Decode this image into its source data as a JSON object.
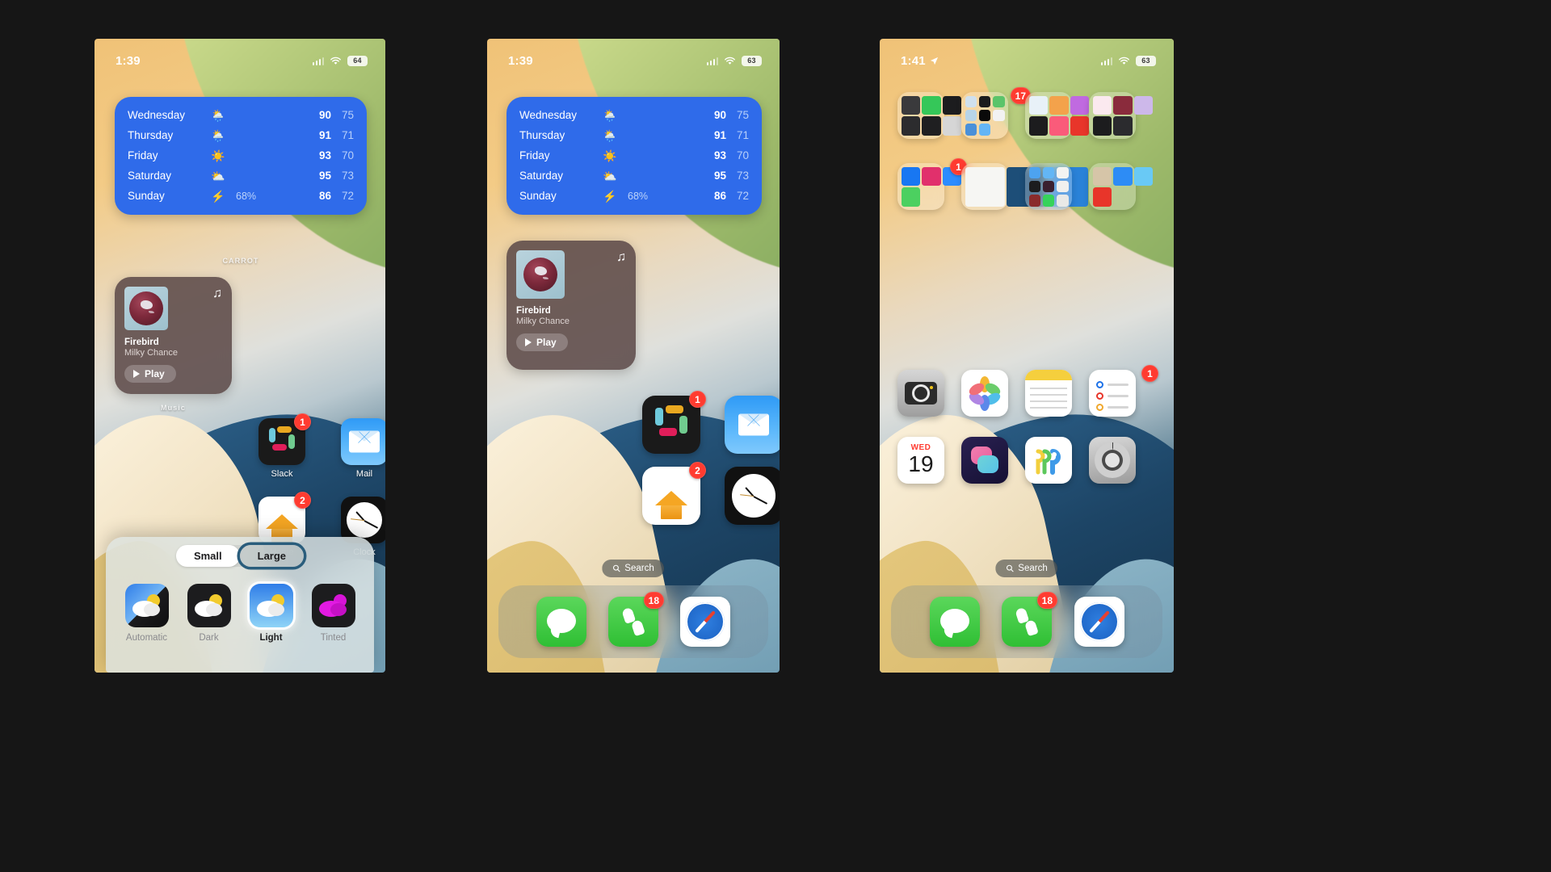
{
  "screens": [
    {
      "id": "screen-edit-mode",
      "status_bar": {
        "time": "1:39",
        "location_arrow": false,
        "battery": "64"
      },
      "weather_widget": {
        "caption": "CARROT",
        "rows": [
          {
            "day": "Wednesday",
            "icon": "rain-sun-icon",
            "glyph": "🌦️",
            "precip": "",
            "high": "90",
            "low": "75"
          },
          {
            "day": "Thursday",
            "icon": "rain-sun-icon",
            "glyph": "🌦️",
            "precip": "",
            "high": "91",
            "low": "71"
          },
          {
            "day": "Friday",
            "icon": "sun-icon",
            "glyph": "☀️",
            "precip": "",
            "high": "93",
            "low": "70"
          },
          {
            "day": "Saturday",
            "icon": "partly-cloudy-icon",
            "glyph": "⛅",
            "precip": "",
            "high": "95",
            "low": "73"
          },
          {
            "day": "Sunday",
            "icon": "lightning-icon",
            "glyph": "⚡",
            "precip": "68%",
            "high": "86",
            "low": "72"
          }
        ]
      },
      "music_widget": {
        "caption": "Music",
        "track": "Firebird",
        "artist": "Milky Chance",
        "play_label": "Play",
        "note_glyph": "♫"
      },
      "apps": [
        {
          "name": "Slack",
          "icon": "slack-icon",
          "badge": "1"
        },
        {
          "name": "Mail",
          "icon": "mail-icon",
          "badge": ""
        },
        {
          "name": "Home",
          "icon": "home-icon",
          "badge": "2"
        },
        {
          "name": "Clock",
          "icon": "clock-icon",
          "badge": ""
        }
      ],
      "sheet": {
        "size_options": [
          {
            "label": "Small",
            "selected": false
          },
          {
            "label": "Large",
            "selected": true
          }
        ],
        "appearance_options": [
          {
            "label": "Automatic",
            "selected": false
          },
          {
            "label": "Dark",
            "selected": false
          },
          {
            "label": "Light",
            "selected": true
          },
          {
            "label": "Tinted",
            "selected": false
          }
        ]
      }
    },
    {
      "id": "screen-large-icons",
      "status_bar": {
        "time": "1:39",
        "location_arrow": false,
        "battery": "63"
      },
      "weather_widget": {
        "rows": [
          {
            "day": "Wednesday",
            "glyph": "🌦️",
            "precip": "",
            "high": "90",
            "low": "75"
          },
          {
            "day": "Thursday",
            "glyph": "🌦️",
            "precip": "",
            "high": "91",
            "low": "71"
          },
          {
            "day": "Friday",
            "glyph": "☀️",
            "precip": "",
            "high": "93",
            "low": "70"
          },
          {
            "day": "Saturday",
            "glyph": "⛅",
            "precip": "",
            "high": "95",
            "low": "73"
          },
          {
            "day": "Sunday",
            "glyph": "⚡",
            "precip": "68%",
            "high": "86",
            "low": "72"
          }
        ]
      },
      "music_widget": {
        "track": "Firebird",
        "artist": "Milky Chance",
        "play_label": "Play",
        "note_glyph": "♫"
      },
      "apps": [
        {
          "name": "Slack",
          "icon": "slack-icon",
          "badge": "1"
        },
        {
          "name": "Mail",
          "icon": "mail-icon",
          "badge": ""
        },
        {
          "name": "Home",
          "icon": "home-icon",
          "badge": "2"
        },
        {
          "name": "Clock",
          "icon": "clock-icon",
          "badge": ""
        }
      ],
      "search": {
        "label": "Search",
        "icon": "search-icon"
      },
      "dock": [
        {
          "name": "Messages",
          "icon": "messages-icon",
          "badge": ""
        },
        {
          "name": "Phone",
          "icon": "phone-icon",
          "badge": "18"
        },
        {
          "name": "Safari",
          "icon": "safari-icon",
          "badge": ""
        }
      ]
    },
    {
      "id": "screen-home-folders",
      "status_bar": {
        "time": "1:41",
        "location_arrow": true,
        "battery": "63"
      },
      "folders": [
        {
          "name": "folder-utilities",
          "badge": "",
          "tiles": [
            "#3a3a3c",
            "#35c759",
            "#1c1c1e",
            "#2c2c2e",
            "#1f1f21",
            "#d6d6d6"
          ]
        },
        {
          "name": "folder-tools",
          "badge": "17",
          "tiles": [
            "#cfe0ee",
            "#1c1c1e",
            "#5ac46a",
            "#b7d4e8",
            "#0a0a0a",
            "#f2f2f2",
            "#4a90d9",
            "#64b5f6"
          ]
        },
        {
          "name": "folder-media",
          "badge": "",
          "tiles": [
            "#e8f1f8",
            "#f3a24b",
            "#c06ae0",
            "#1c1c1e",
            "#fa5b7a",
            "#e8352a"
          ]
        },
        {
          "name": "folder-health",
          "badge": "",
          "tiles": [
            "#fbe9ef",
            "#8a2b3c",
            "#cdb8ea",
            "#1c1c1e",
            "#2b2b2e"
          ]
        },
        {
          "name": "folder-social",
          "badge": "1",
          "tiles": [
            "#1877f2",
            "#e1306c",
            "#2c8cff",
            "#4cd060"
          ]
        },
        {
          "name": "folder-blank",
          "badge": "",
          "tiles": [
            "#f6f6f3",
            "#1d4e78",
            "#2a82d8"
          ]
        },
        {
          "name": "folder-productivity",
          "badge": "",
          "tiles": [
            "#4da3f0",
            "#63b6f5",
            "#f4f4f2",
            "#1c1c1e",
            "#3a2030",
            "#f0f0ee",
            "#8a2b2b",
            "#36d35a",
            "#e9e9e7"
          ]
        },
        {
          "name": "folder-shopping",
          "badge": "",
          "tiles": [
            "#d6c5a8",
            "#2d8cf5",
            "#69c9f5",
            "#e8352a"
          ]
        }
      ],
      "apps": [
        {
          "name": "Camera",
          "icon": "camera-icon",
          "badge": ""
        },
        {
          "name": "Photos",
          "icon": "photos-icon",
          "badge": ""
        },
        {
          "name": "Notes",
          "icon": "notes-icon",
          "badge": ""
        },
        {
          "name": "Reminders",
          "icon": "reminders-icon",
          "badge": "1"
        },
        {
          "name": "Calendar",
          "icon": "calendar-icon",
          "badge": "",
          "weekday": "WED",
          "day": "19"
        },
        {
          "name": "Shortcuts",
          "icon": "shortcuts-icon",
          "badge": ""
        },
        {
          "name": "Passwords",
          "icon": "passwords-icon",
          "badge": ""
        },
        {
          "name": "Settings",
          "icon": "settings-icon",
          "badge": ""
        }
      ],
      "search": {
        "label": "Search",
        "icon": "search-icon"
      },
      "dock": [
        {
          "name": "Messages",
          "icon": "messages-icon",
          "badge": ""
        },
        {
          "name": "Phone",
          "icon": "phone-icon",
          "badge": "18"
        },
        {
          "name": "Safari",
          "icon": "safari-icon",
          "badge": ""
        }
      ]
    }
  ],
  "colors": {
    "widget_blue": "#2f6bea",
    "badge_red": "#ff3b30",
    "selection_ring": "#2a5d7c"
  }
}
